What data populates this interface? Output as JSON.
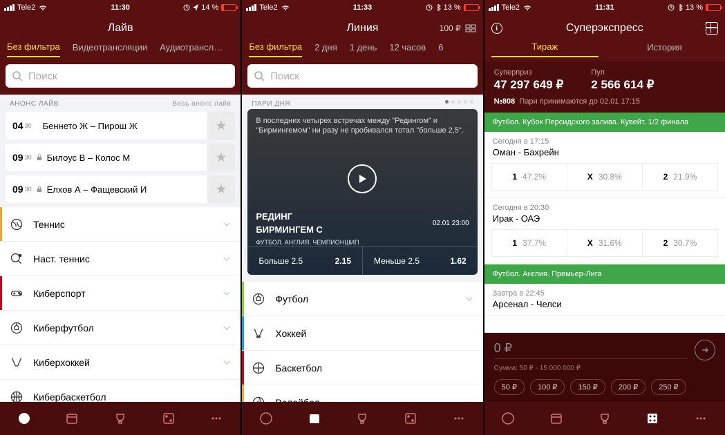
{
  "status": {
    "carrier": "Tele2",
    "wifi": "wifi",
    "alarm": true,
    "loc": true,
    "bt": true
  },
  "screen1": {
    "time": "11:30",
    "battery": "14 %",
    "title": "Лайв",
    "tabs": [
      "Без фильтра",
      "Видеотрансляции",
      "Аудиотрансл…"
    ],
    "search_ph": "Поиск",
    "anons_label": "АНОНС ЛАЙВ",
    "anons_all": "Весь анонс лайв",
    "events": [
      {
        "h": "04",
        "m": "30",
        "lock": false,
        "txt": "Беннето Ж – Пирош Ж"
      },
      {
        "h": "09",
        "m": "30",
        "lock": true,
        "txt": "Билоус В – Колос М"
      },
      {
        "h": "09",
        "m": "30",
        "lock": true,
        "txt": "Елхов А – Фащевский И"
      }
    ],
    "sports": [
      "Теннис",
      "Наст. теннис",
      "Киберспорт",
      "Киберфутбол",
      "Киберхоккей",
      "Кибербаскетбол"
    ]
  },
  "screen2": {
    "time": "11:33",
    "battery": "13 %",
    "title": "Линия",
    "balance": "100 ₽",
    "tabs": [
      "Без фильтра",
      "2 дня",
      "1 день",
      "12 часов",
      "6"
    ],
    "search_ph": "Поиск",
    "pari_label": "ПАРИ ДНЯ",
    "featured": {
      "desc": "В последних четырех встречах между \"Редингом\" и \"Бирмингемом\" ни разу не пробивался тотал \"больше 2,5\".",
      "team1": "РЕДИНГ",
      "team2": "БИРМИНГЕМ С",
      "league": "ФУТБОЛ. АНГЛИЯ. ЧЕМПИОНШИП",
      "dt": "02.01 23:00",
      "o1l": "Больше 2.5",
      "o1v": "2.15",
      "o2l": "Меньше 2.5",
      "o2v": "1.62"
    },
    "sports": [
      "Футбол",
      "Хоккей",
      "Баскетбол",
      "Волейбол"
    ]
  },
  "screen3": {
    "time": "11:31",
    "battery": "13 %",
    "title": "Суперэкспресс",
    "tabs": [
      "Тираж",
      "История"
    ],
    "sp_label": "Суперприз",
    "sp_val": "47 297 649 ₽",
    "pool_label": "Пул",
    "pool_val": "2 566 614 ₽",
    "draw_no": "№808",
    "accept": "Пари принимаются до 02.01 17:15",
    "green1": "Футбол. Кубок Персидского залива. Кувейт. 1/2 финала",
    "m1_time": "Сегодня в 17:15",
    "m1": "Оман - Бахрейн",
    "m1_o": [
      "47.2%",
      "30.8%",
      "21.9%"
    ],
    "m2_time": "Сегодня в 20:30",
    "m2": "Ирак - ОАЭ",
    "m2_o": [
      "37.7%",
      "31.6%",
      "30.7%"
    ],
    "green2": "Футбол. Англия. Премьер-Лига",
    "m3_time": "Завтра в 22:45",
    "m3": "Арсенал - Челси",
    "stake_ph": "0 ₽",
    "stake_hint": "Сумма: 50 ₽ - 15 000 000 ₽",
    "chips": [
      "50 ₽",
      "100 ₽",
      "150 ₽",
      "200 ₽",
      "250 ₽"
    ]
  }
}
